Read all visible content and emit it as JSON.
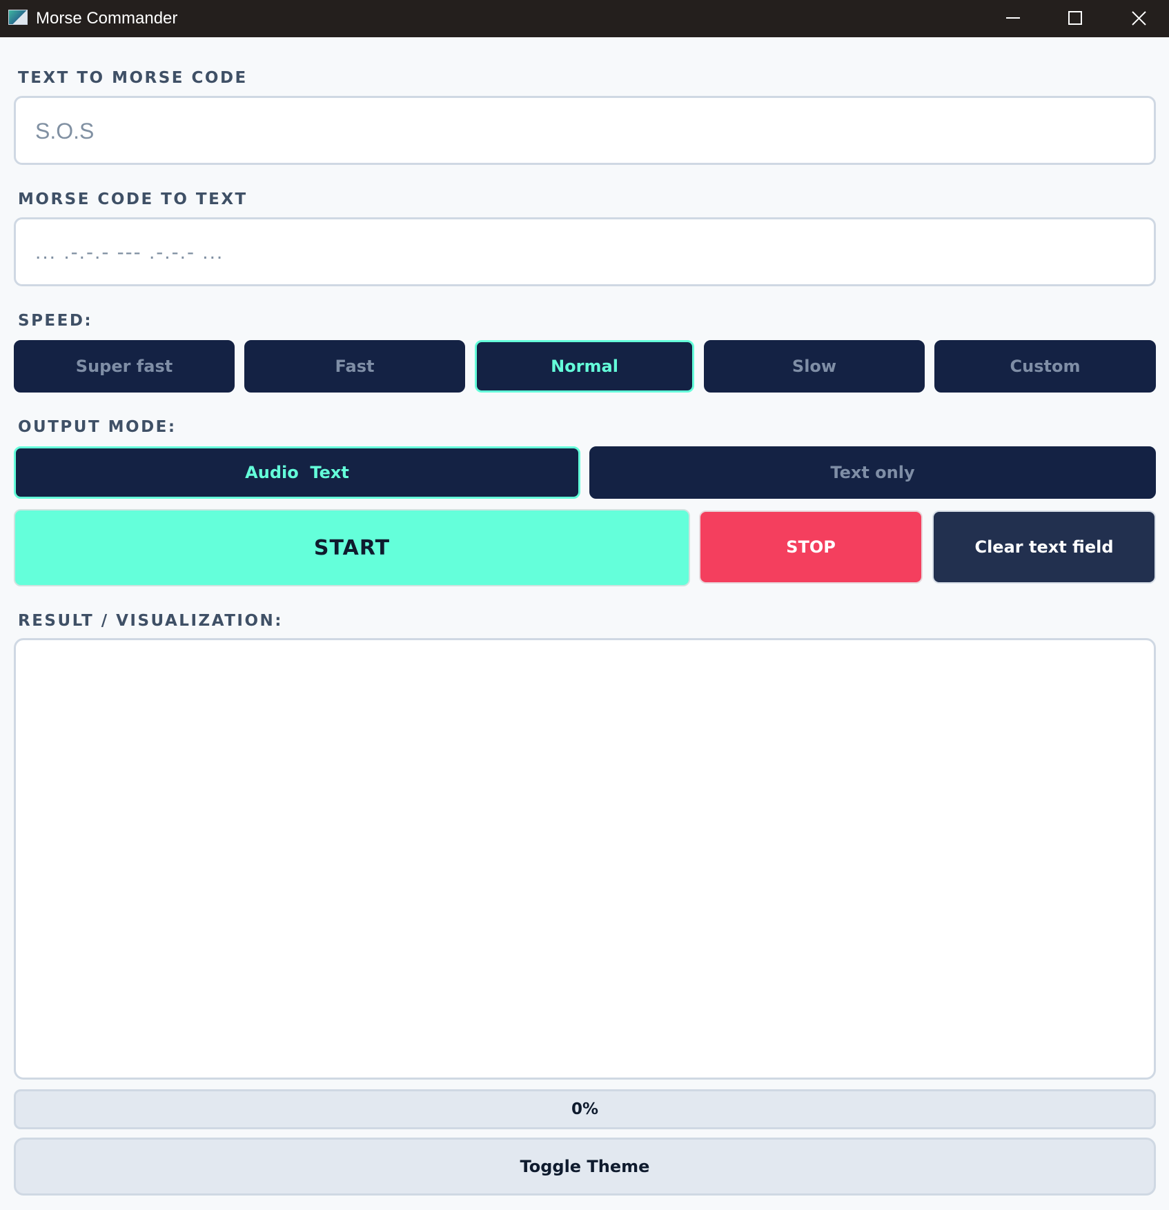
{
  "window": {
    "title": "Morse Commander",
    "icons": {
      "app": "app-icon",
      "minimize": "minimize-icon",
      "maximize": "maximize-icon",
      "close": "close-icon"
    }
  },
  "text_to_morse": {
    "label": "TEXT TO MORSE CODE",
    "value": "",
    "placeholder": "S.O.S"
  },
  "morse_to_text": {
    "label": "MORSE CODE TO TEXT",
    "value": "",
    "placeholder": "... .-.-.- --- .-.-.- ..."
  },
  "speed": {
    "label": "SPEED:",
    "options": [
      "Super fast",
      "Fast",
      "Normal",
      "Slow",
      "Custom"
    ],
    "selected": "Normal"
  },
  "output_mode": {
    "label": "OUTPUT MODE:",
    "options": [
      "Audio  Text",
      "Text only"
    ],
    "selected": "Audio  Text"
  },
  "actions": {
    "start_label": "START",
    "stop_label": "STOP",
    "clear_label": "Clear text field"
  },
  "result": {
    "label": "RESULT / VISUALIZATION:",
    "content": ""
  },
  "progress": {
    "percent": 0,
    "text": "0%"
  },
  "theme": {
    "toggle_label": "Toggle Theme"
  },
  "colors": {
    "accent": "#64ffda",
    "button_dark": "#142244",
    "stop": "#f43f5e",
    "clear": "#22304f",
    "titlebar": "#241f1d"
  }
}
